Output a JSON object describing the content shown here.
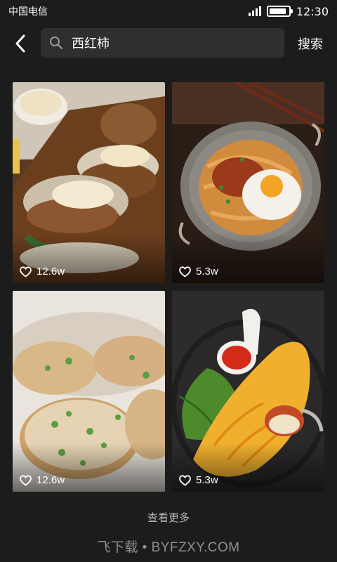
{
  "status_bar": {
    "carrier": "中国电信",
    "time": "12:30",
    "battery_level": 0.9,
    "signal_icon": "signal-icon"
  },
  "search": {
    "back_icon": "back-arrow-icon",
    "search_icon": "search-icon",
    "query": "西红柿",
    "action_label": "搜索"
  },
  "results": [
    {
      "likes": "12.6w",
      "like_icon": "heart-icon",
      "photo": "falafel-burger-photo",
      "accent": "#7a4a22"
    },
    {
      "likes": "5.3w",
      "like_icon": "heart-icon",
      "photo": "noodle-fried-egg-photo",
      "accent": "#b5641f"
    },
    {
      "likes": "12.6w",
      "like_icon": "heart-icon",
      "photo": "potato-scallion-cake-photo",
      "accent": "#c79a5a"
    },
    {
      "likes": "5.3w",
      "like_icon": "heart-icon",
      "photo": "omelette-rice-photo",
      "accent": "#e6a21f"
    }
  ],
  "footer": {
    "more_label": "查看更多",
    "watermark": "飞下载 • BYFZXY.COM"
  }
}
